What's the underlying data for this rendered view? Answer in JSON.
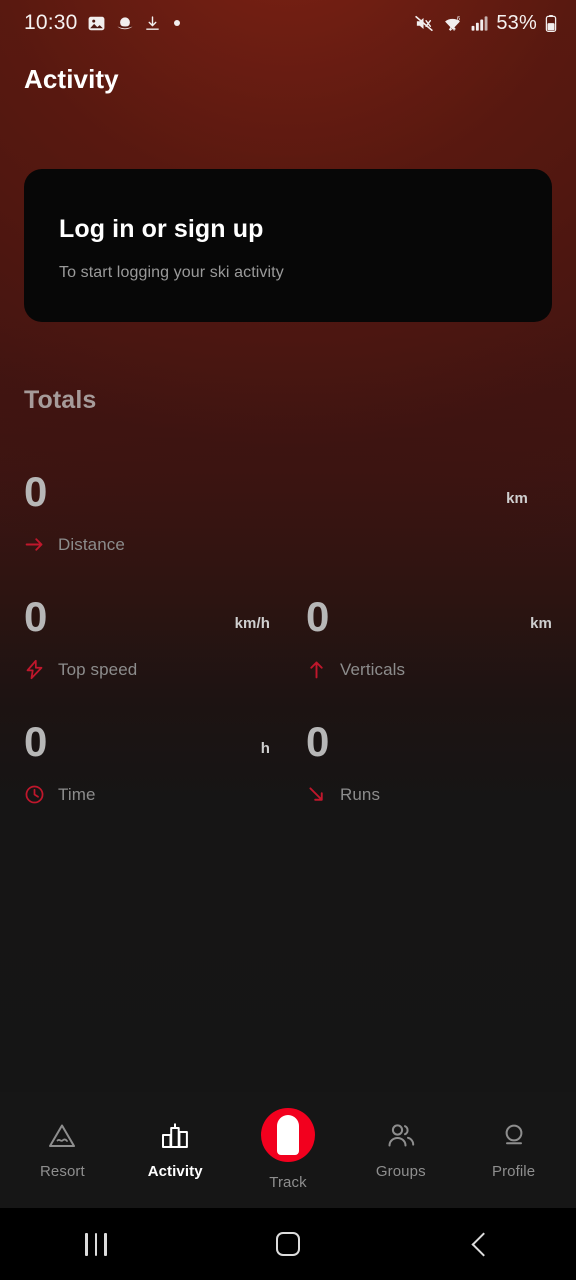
{
  "status_bar": {
    "time": "10:30",
    "left_icons": [
      "image-icon",
      "saturn-icon",
      "download-icon",
      "dot-indicator"
    ],
    "battery_percent": "53%",
    "right_icons": [
      "mute-icon",
      "wifi-icon",
      "cellular-signal-icon",
      "battery-icon"
    ]
  },
  "header": {
    "title": "Activity"
  },
  "login_card": {
    "title": "Log in or sign up",
    "subtitle": "To start logging your ski activity"
  },
  "totals": {
    "heading": "Totals",
    "stats": [
      {
        "value": "0",
        "unit": "km",
        "label": "Distance",
        "icon": "arrow-right-icon"
      },
      {
        "value": "0",
        "unit": "km/h",
        "label": "Top speed",
        "icon": "lightning-bolt-icon"
      },
      {
        "value": "0",
        "unit": "km",
        "label": "Verticals",
        "icon": "arrow-up-icon"
      },
      {
        "value": "0",
        "unit": "h",
        "label": "Time",
        "icon": "clock-icon"
      },
      {
        "value": "0",
        "unit": "",
        "label": "Runs",
        "icon": "arrow-down-right-icon"
      }
    ]
  },
  "bottom_nav": {
    "items": [
      {
        "label": "Resort",
        "icon": "mountain-icon",
        "active": false
      },
      {
        "label": "Activity",
        "icon": "bar-chart-icon",
        "active": true
      },
      {
        "label": "Track",
        "icon": "track-ski-icon",
        "active": false
      },
      {
        "label": "Groups",
        "icon": "people-icon",
        "active": false
      },
      {
        "label": "Profile",
        "icon": "person-icon",
        "active": false
      }
    ]
  },
  "system_nav": {
    "items": [
      "recents-button",
      "home-button",
      "back-button"
    ]
  },
  "colors": {
    "accent_red": "#f2001e",
    "icon_red": "#c0172c",
    "background_top": "#4e1710",
    "background_bottom": "#151515",
    "card_background": "#070707"
  }
}
